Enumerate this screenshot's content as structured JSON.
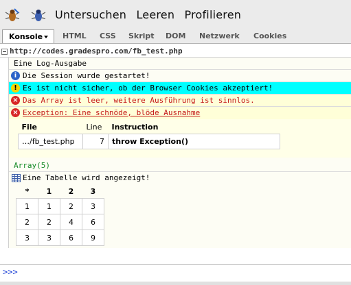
{
  "menu": {
    "items": [
      "Untersuchen",
      "Leeren",
      "Profilieren"
    ]
  },
  "tabs": {
    "active": "Konsole",
    "items": [
      "HTML",
      "CSS",
      "Skript",
      "DOM",
      "Netzwerk",
      "Cookies"
    ]
  },
  "group": {
    "title": "http://codes.gradespro.com/fb_test.php"
  },
  "messages": {
    "log": "Eine Log-Ausgabe",
    "info": "Die Session wurde gestartet!",
    "warn": "Es ist nicht sicher, ob der Browser Cookies akzeptiert!",
    "error": "Das Array ist leer, weitere Ausführung ist sinnlos.",
    "exception": "Exception: Eine schnöde, blöde Ausnahme"
  },
  "trace": {
    "headers": [
      "File",
      "Line",
      "Instruction"
    ],
    "row": [
      "…/fb_test.php",
      "7",
      "throw Exception()"
    ]
  },
  "array_summary": "Array(5)",
  "table_label": "Eine Tabelle wird angezeigt!",
  "grid": {
    "headers": [
      "*",
      "1",
      "2",
      "3"
    ],
    "rows": [
      [
        "1",
        "1",
        "2",
        "3"
      ],
      [
        "2",
        "2",
        "4",
        "6"
      ],
      [
        "3",
        "3",
        "6",
        "9"
      ]
    ]
  },
  "prompt": ">>>",
  "colors": {
    "warn_row": "#00ffff",
    "error_row": "#ffffd8",
    "info_icon": "#2b63c8",
    "error_icon": "#d82727",
    "prompt": "#1a3fd6"
  },
  "icons": [
    "firebug-inspect-icon",
    "firebug-bug-icon",
    "info-icon",
    "warning-icon",
    "error-icon",
    "table-icon"
  ]
}
